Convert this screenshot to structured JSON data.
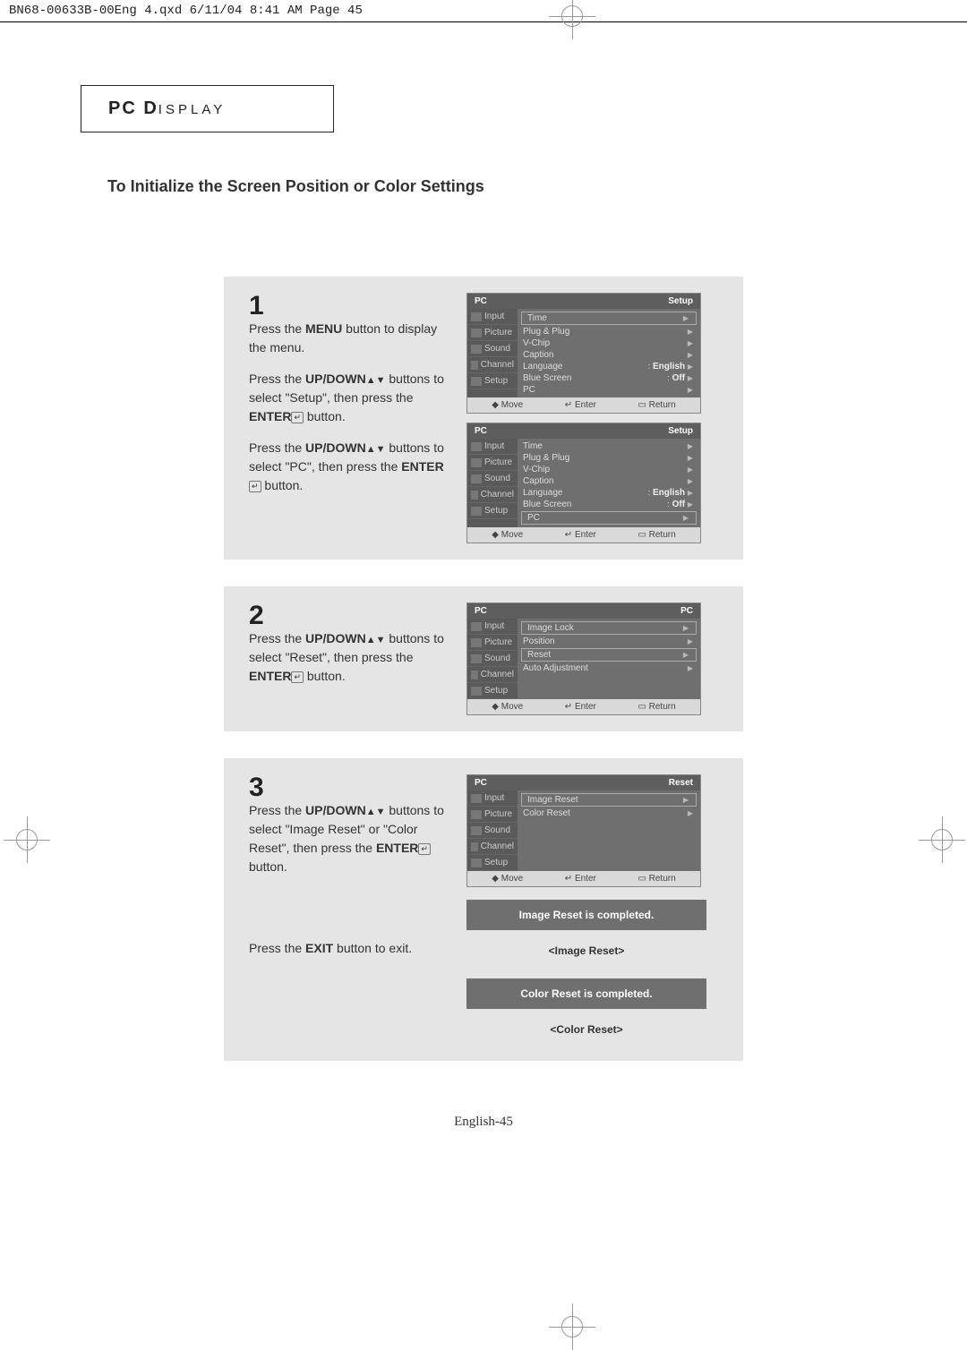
{
  "doc_header": "BN68-00633B-00Eng 4.qxd  6/11/04 8:41 AM  Page 45",
  "section": {
    "pc": "PC D",
    "display": "ISPLAY"
  },
  "subtitle": "To Initialize the Screen Position or Color Settings",
  "labels": {
    "menu": "MENU",
    "updown": "UP/DOWN",
    "enter": "ENTER",
    "exit": "EXIT",
    "arrows": "▲▼",
    "enter_glyph": "↵"
  },
  "steps": {
    "s1": {
      "num": "1",
      "p1a": "Press the ",
      "p1c": " button to display the menu.",
      "p2a": "Press the ",
      "p2c": " buttons to select \"Setup\", then press the ",
      "p2e": " button.",
      "p3a": "Press the ",
      "p3c": " buttons to select \"PC\", then press the ",
      "p3e": " button."
    },
    "s2": {
      "num": "2",
      "p1a": "Press the ",
      "p1c": " buttons to select \"Reset\", then press the ",
      "p1e": " button."
    },
    "s3": {
      "num": "3",
      "p1a": "Press the ",
      "p1c": " buttons to select \"Image Reset\" or \"Color Reset\", then press the ",
      "p1e": " button.",
      "p2a": "Press the ",
      "p2c": " button to exit."
    }
  },
  "osd": {
    "side": [
      "Input",
      "Picture",
      "Sound",
      "Channel",
      "Setup"
    ],
    "footer": {
      "move": "Move",
      "enter": "Enter",
      "return": "Return",
      "move_sym": "◆",
      "enter_sym": "↵",
      "return_sym": "▭"
    },
    "setup1": {
      "title_left": "PC",
      "title_right": "Setup",
      "items": [
        {
          "k": "Time",
          "boxed": true
        },
        {
          "k": "Plug & Plug"
        },
        {
          "k": "V-Chip"
        },
        {
          "k": "Caption"
        },
        {
          "k": "Language",
          "v": "English"
        },
        {
          "k": "Blue Screen",
          "v": "Off"
        },
        {
          "k": "PC"
        }
      ]
    },
    "setup2": {
      "title_left": "PC",
      "title_right": "Setup",
      "items": [
        {
          "k": "Time"
        },
        {
          "k": "Plug & Plug"
        },
        {
          "k": "V-Chip"
        },
        {
          "k": "Caption"
        },
        {
          "k": "Language",
          "v": "English"
        },
        {
          "k": "Blue Screen",
          "v": "Off"
        },
        {
          "k": "PC",
          "boxed": true
        }
      ]
    },
    "pc": {
      "title_left": "PC",
      "title_right": "PC",
      "items": [
        {
          "k": "Image Lock",
          "boxed": true
        },
        {
          "k": "Position"
        },
        {
          "k": "Reset",
          "boxed": true
        },
        {
          "k": "Auto Adjustment"
        }
      ]
    },
    "reset": {
      "title_left": "PC",
      "title_right": "Reset",
      "items": [
        {
          "k": "Image Reset",
          "boxed": true
        },
        {
          "k": "Color Reset"
        }
      ]
    }
  },
  "banners": {
    "img_msg": "Image Reset is completed.",
    "img_lbl": "<Image Reset>",
    "col_msg": "Color Reset is completed.",
    "col_lbl": "<Color Reset>"
  },
  "page_num": "English-45"
}
